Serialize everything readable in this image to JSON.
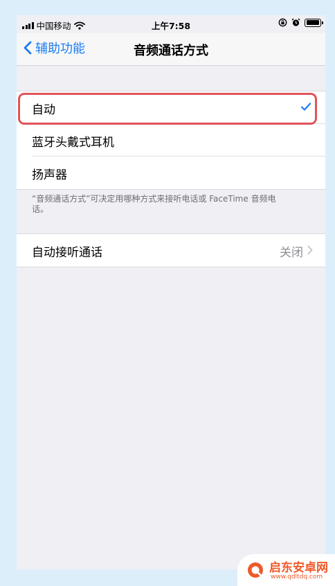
{
  "status_bar": {
    "carrier": "中国移动",
    "time": "上午7:58",
    "icons": [
      "signal-bars-icon",
      "wifi-icon",
      "orientation-lock-icon",
      "alarm-icon",
      "battery-icon"
    ]
  },
  "nav": {
    "back_label": "辅助功能",
    "title": "音频通话方式"
  },
  "routing_options": [
    {
      "label": "自动",
      "selected": true
    },
    {
      "label": "蓝牙头戴式耳机",
      "selected": false
    },
    {
      "label": "扬声器",
      "selected": false
    }
  ],
  "routing_footer": "“音频通话方式”可决定用哪种方式来接听电话或 FaceTime 音频电话。",
  "auto_answer": {
    "label": "自动接听通话",
    "value": "关闭"
  },
  "watermark": {
    "name": "启东安卓网",
    "url": "www.qdltdq.com"
  },
  "colors": {
    "accent": "#1b7cf3",
    "highlight": "#e0535a",
    "background": "#efeff4"
  }
}
